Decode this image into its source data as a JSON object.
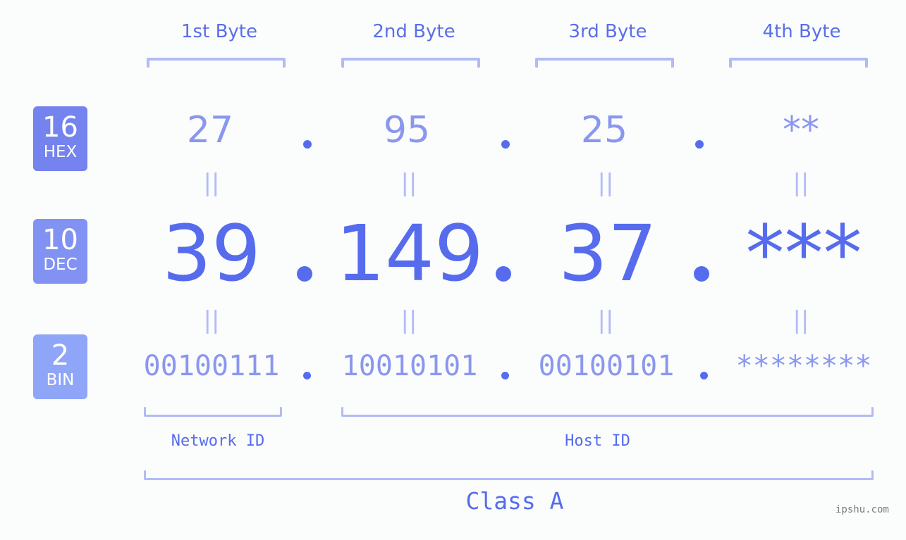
{
  "bytes": [
    {
      "label": "1st Byte",
      "hex": "27",
      "dec": "39",
      "bin": "00100111"
    },
    {
      "label": "2nd Byte",
      "hex": "95",
      "dec": "149",
      "bin": "10010101"
    },
    {
      "label": "3rd Byte",
      "hex": "25",
      "dec": "37",
      "bin": "00100101"
    },
    {
      "label": "4th Byte",
      "hex": "**",
      "dec": "***",
      "bin": "********"
    }
  ],
  "bases": {
    "hex": {
      "num": "16",
      "label": "HEX",
      "color": "#7483ee"
    },
    "dec": {
      "num": "10",
      "label": "DEC",
      "color": "#8292f2"
    },
    "bin": {
      "num": "2",
      "label": "BIN",
      "color": "#8fa5f8"
    }
  },
  "equals_symbol": "||",
  "sections": {
    "network_id": "Network ID",
    "host_id": "Host ID",
    "class": "Class A"
  },
  "colors": {
    "accent": "#566ced",
    "light_text": "#8a97ef",
    "bracket": "#b2bbf7",
    "background": "#fbfcfc"
  },
  "watermark": "ipshu.com"
}
